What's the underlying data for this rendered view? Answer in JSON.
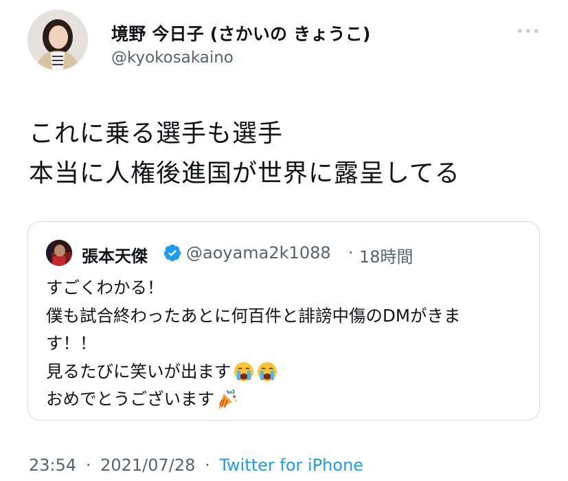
{
  "author": {
    "display_name": "境野 今日子 (さかいの きょうこ)",
    "handle": "@kyokosakaino"
  },
  "tweet": {
    "lines": [
      "これに乗る選手も選手",
      "本当に人権後進国が世界に露呈してる"
    ]
  },
  "quote": {
    "display_name": "張本天傑",
    "handle": "@aoyama2k1088",
    "separator": "·",
    "time": "18時間",
    "lines": [
      "すごくわかる！",
      "僕も試合終わったあとに何百件と誹謗中傷のDMがきま",
      "す！！",
      "見るたびに笑いが出ます",
      "おめでとうございます"
    ]
  },
  "footer": {
    "time": "23:54",
    "sep": "·",
    "date": "2021/07/28",
    "source": "Twitter for iPhone"
  },
  "colors": {
    "text": "#0f1419",
    "secondary": "#536471",
    "accent": "#1d9bf0",
    "border": "#cfd9de"
  },
  "icons": [
    "more-horizontal-icon",
    "verified-badge-icon",
    "crying-face-emoji",
    "party-popper-emoji"
  ]
}
